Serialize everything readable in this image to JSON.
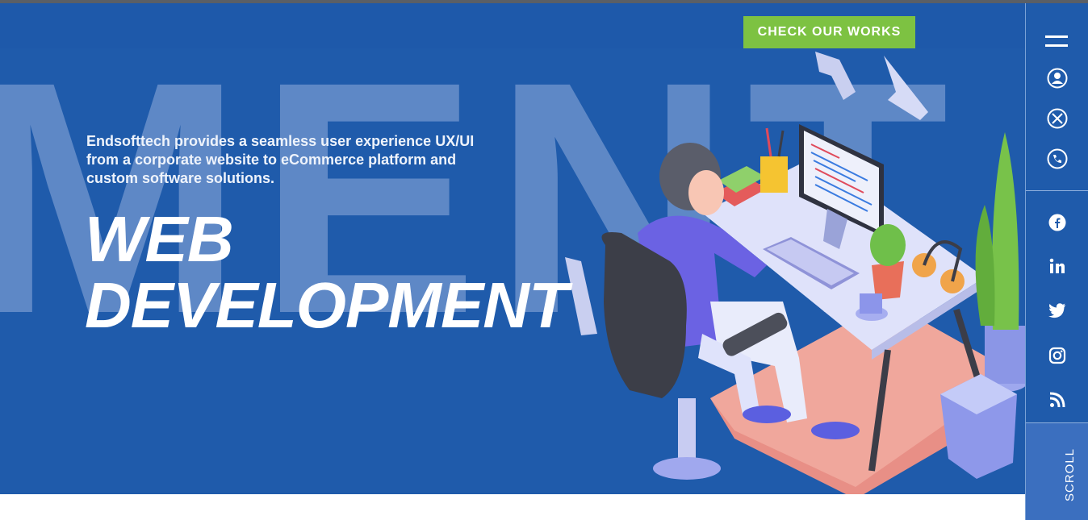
{
  "background_word": "MENT W",
  "header": {
    "cta_label": "CHECK OUR WORKS"
  },
  "hero": {
    "tagline": "Endsofttech provides a seamless user experience UX/UI from a corporate website to eCommerce platform and custom software solutions.",
    "title_line1": "WEB",
    "title_line2": "DEVELOPMENT"
  },
  "sidebar": {
    "nav_icons": [
      "menu-icon",
      "user-icon",
      "tools-icon",
      "phone-icon"
    ],
    "social_icons": [
      "facebook-icon",
      "linkedin-icon",
      "twitter-icon",
      "instagram-icon",
      "rss-icon"
    ],
    "scroll_label": "SCROLL"
  },
  "colors": {
    "hero_blue": "#1f5bab",
    "cta_green": "#7dc242",
    "white": "#ffffff"
  }
}
